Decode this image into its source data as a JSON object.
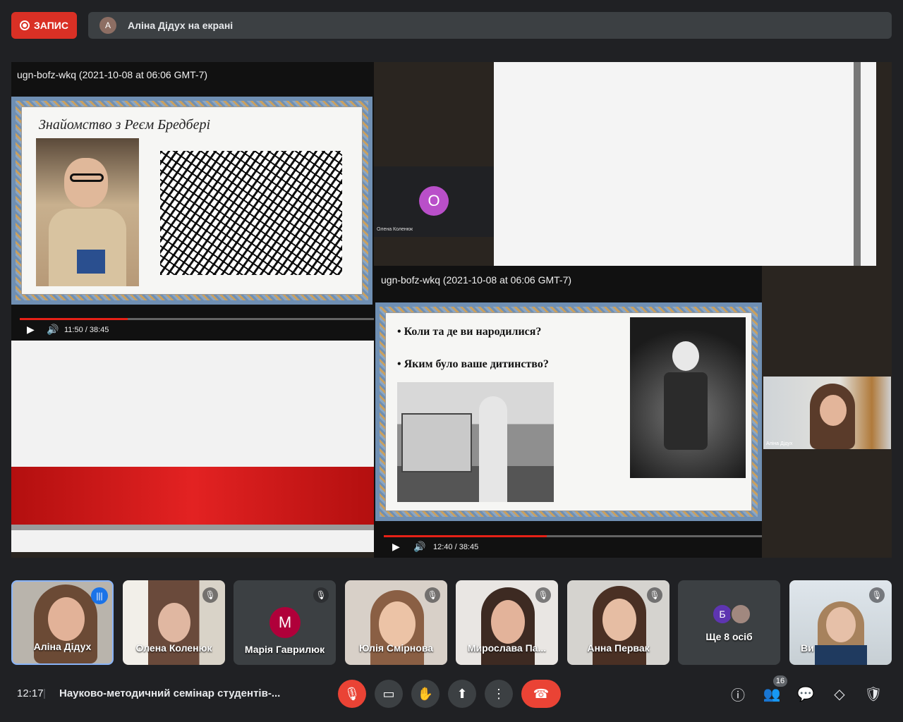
{
  "top": {
    "record_label": "ЗАПИС",
    "presenter_initial": "А",
    "presenting_text": "Аліна Дідух на екрані"
  },
  "screen": {
    "video_left": {
      "title": "ugn-bofz-wkq (2021-10-08 at 06:06 GMT-7)",
      "slide_heading": "Знайомство з Реєм Бредбері",
      "time": "11:50 / 38:45",
      "progress": 0.305
    },
    "video_right": {
      "title": "ugn-bofz-wkq (2021-10-08 at 06:06 GMT-7)",
      "bullet1": "• Коли та де ви народилися?",
      "bullet2": "• Яким було ваше дитинство?",
      "time": "12:40 / 38:45",
      "progress": 0.327
    },
    "thumb_participant": {
      "initial": "О",
      "name": "Олена Коленюк",
      "color": "#b94fc9"
    },
    "thumb_presenter": {
      "name": "Аліна Дідух"
    }
  },
  "participants": [
    {
      "name": "Аліна Дідух",
      "speaking": true
    },
    {
      "name": "Олена Коленюк",
      "muted": true
    },
    {
      "name": "Марія Гаврилюк",
      "initial": "M",
      "color": "#b0003a",
      "muted": true
    },
    {
      "name": "Юлія Смірнова",
      "muted": true
    },
    {
      "name": "Мирослава Па...",
      "muted": true
    },
    {
      "name": "Анна Первак",
      "muted": true
    },
    {
      "name": "Ще 8 осіб",
      "initial": "Б",
      "color": "#5e35b1"
    },
    {
      "name": "Ви",
      "muted": true
    }
  ],
  "bottom": {
    "time": "12:17",
    "meeting_title": "Науково-методичний семінар студентів-...",
    "participants_count": "16"
  },
  "colors": {
    "record": "#d93025",
    "end_call": "#ea4335",
    "youtube_red": "#e62117"
  }
}
